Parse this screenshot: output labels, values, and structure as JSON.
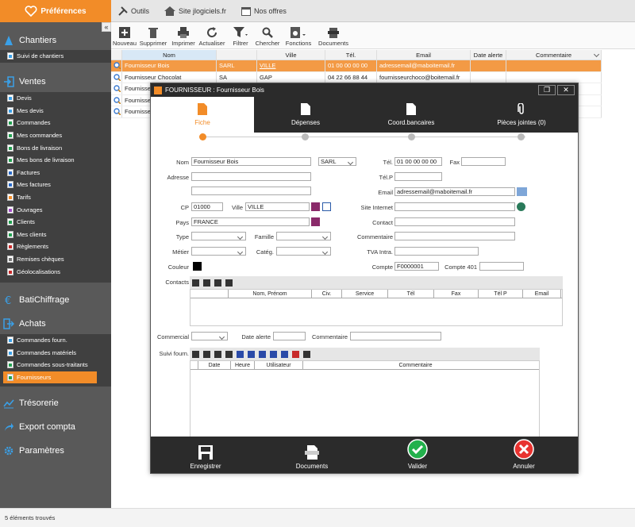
{
  "sidebar": {
    "prefs_label": "Préférences",
    "sections": {
      "chantiers": "Chantiers",
      "ventes": "Ventes",
      "batichiffrage": "BatiChiffrage",
      "achats": "Achats",
      "tresorerie": "Trésorerie",
      "export": "Export compta",
      "parametres": "Paramètres"
    },
    "chantiers_items": [
      "Suivi de chantiers"
    ],
    "ventes_items": [
      "Devis",
      "Mes devis",
      "Commandes",
      "Mes commandes",
      "Bons de livraison",
      "Mes bons de livraison",
      "Factures",
      "Mes factures",
      "Tarifs",
      "Ouvrages",
      "Clients",
      "Mes clients",
      "Règlements",
      "Remises chèques",
      "Géolocalisations"
    ],
    "achats_items": [
      "Commandes fourn.",
      "Commandes matériels",
      "Commandes sous-traitants",
      "Fournisseurs"
    ]
  },
  "topbar": {
    "outils": "Outils",
    "site": "Site jlogiciels.fr",
    "offres": "Nos offres"
  },
  "toolbar": {
    "nouveau": "Nouveau",
    "supprimer": "Supprimer",
    "imprimer": "Imprimer",
    "actualiser": "Actualiser",
    "filtrer": "Filtrer",
    "chercher": "Chercher",
    "fonctions": "Fonctions",
    "documents": "Documents"
  },
  "grid": {
    "headers": [
      "Nom",
      "",
      "Ville",
      "Tél.",
      "Email",
      "Date alerte",
      "Commentaire"
    ],
    "rows": [
      [
        "Fournisseur Bois",
        "SARL",
        "VILLE",
        "01 00 00 00 00",
        "adressemail@maboitemail.fr",
        "",
        ""
      ],
      [
        "Fournisseur Chocolat",
        "SA",
        "GAP",
        "04 22 66 88 44",
        "fournisseurchoco@boitemail.fr",
        "",
        ""
      ],
      [
        "Fournisse",
        "",
        "",
        "",
        "",
        "",
        ""
      ],
      [
        "Fournisse",
        "",
        "",
        "",
        "",
        "",
        ""
      ],
      [
        "Fournisse",
        "",
        "",
        "",
        "",
        "",
        ""
      ]
    ]
  },
  "status": "5 éléments trouvés",
  "dialog": {
    "title": "FOURNISSEUR : Fournisseur Bois",
    "tabs": [
      "Fiche",
      "Dépenses",
      "Coord.bancaires",
      "Pièces jointes (0)"
    ],
    "labels": {
      "nom": "Nom",
      "adresse": "Adresse",
      "cp": "CP",
      "ville": "Ville",
      "pays": "Pays",
      "type": "Type",
      "famille": "Famille",
      "metier": "Métier",
      "categ": "Catég.",
      "couleur": "Couleur",
      "contacts": "Contacts",
      "tel": "Tél.",
      "fax": "Fax",
      "telp": "Tél.P",
      "email": "Email",
      "site": "Site Internet",
      "contact": "Contact",
      "commentaire": "Commentaire",
      "tva": "TVA Intra.",
      "compte": "Compte",
      "compte401": "Compte 401",
      "commercial": "Commercial",
      "date_alerte": "Date alerte",
      "commentaire2": "Commentaire",
      "suivi": "Suivi fourn."
    },
    "values": {
      "nom": "Fournisseur Bois",
      "forme": "SARL",
      "cp": "01000",
      "ville": "VILLE",
      "pays": "FRANCE",
      "tel": "01 00 00 00 00",
      "email": "adressemail@maboitemail.fr",
      "compte": "F0000001"
    },
    "contacts_headers": [
      "Nom, Prénom",
      "Civ.",
      "Service",
      "Tél",
      "Fax",
      "Tél P",
      "Email"
    ],
    "suivi_headers": [
      "Date",
      "Heure",
      "Utilisateur",
      "Commentaire"
    ],
    "footer": {
      "enregistrer": "Enregistrer",
      "documents": "Documents",
      "valider": "Valider",
      "annuler": "Annuler"
    }
  },
  "colors": {
    "accent": "#f28c28",
    "sidebar": "#595959",
    "dark": "#2b2b2b",
    "valider": "#22b14c",
    "annuler": "#e8322f"
  }
}
